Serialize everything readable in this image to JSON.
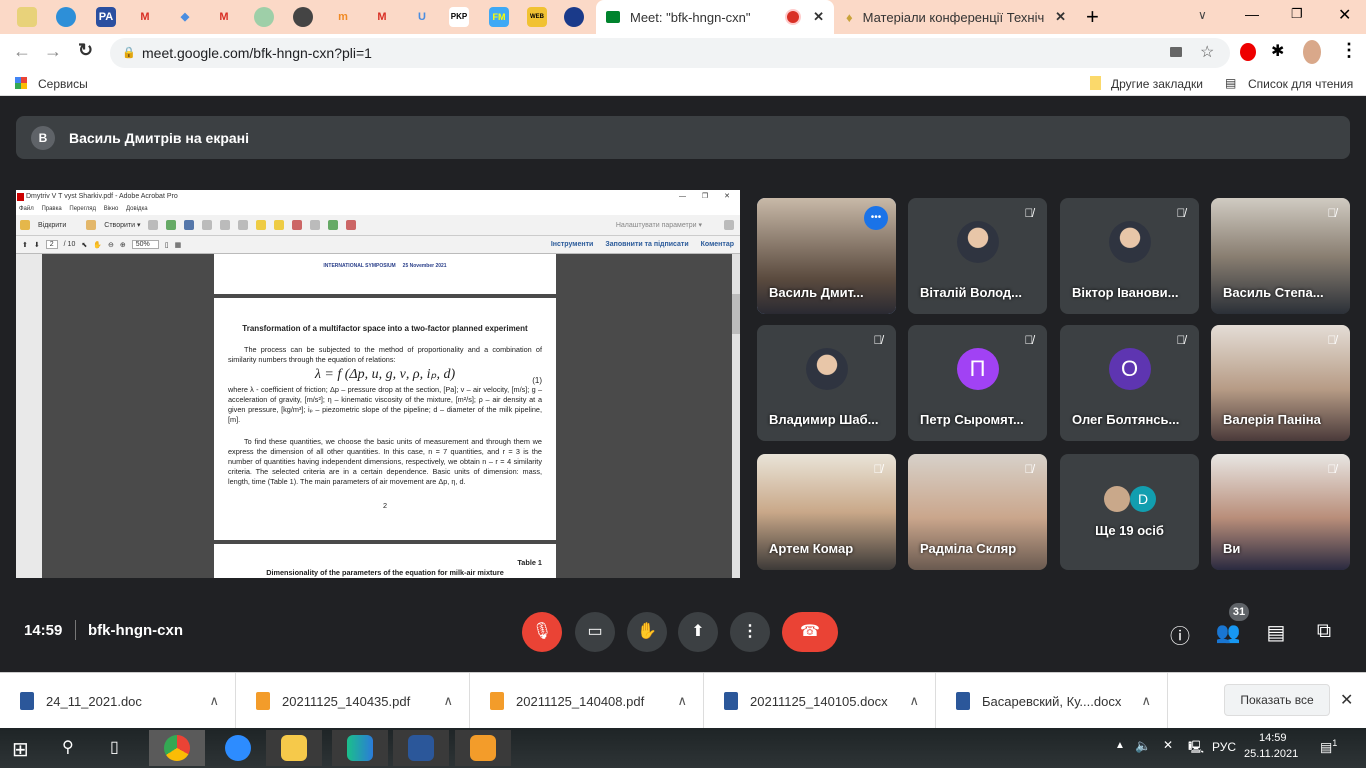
{
  "browser": {
    "pinned_tabs": [
      "crest",
      "drop",
      "pa",
      "gmail",
      "cap",
      "gmail",
      "emblem",
      "globe",
      "m",
      "gmail",
      "u",
      "PKP",
      "FM",
      "WEB",
      "eu"
    ],
    "active_tab": {
      "title": "Meet: \"bfk-hngn-cxn\""
    },
    "other_tab": {
      "title": "Матеріали конференції Технічн"
    },
    "url": "meet.google.com/bfk-hngn-cxn?pli=1",
    "bookmarks": {
      "apps": "Сервисы",
      "other": "Другие закладки",
      "reading_list": "Список для чтения"
    }
  },
  "meet": {
    "presenter_banner": {
      "initial": "В",
      "text": "Василь Дмитрів на екрані"
    },
    "participants": [
      {
        "name": "Василь Дмит...",
        "type": "video",
        "speaking": true
      },
      {
        "name": "Віталій Волод...",
        "type": "photo"
      },
      {
        "name": "Віктор Іванови...",
        "type": "photo"
      },
      {
        "name": "Василь Степа...",
        "type": "video"
      },
      {
        "name": "Владимир Шаб...",
        "type": "photo"
      },
      {
        "name": "Петр Сыромят...",
        "type": "letter",
        "letter": "П",
        "color": "#a142f4"
      },
      {
        "name": "Олег Болтянсь...",
        "type": "letter",
        "letter": "О",
        "color": "#5e35b1"
      },
      {
        "name": "Валерія Паніна",
        "type": "video"
      },
      {
        "name": "Артем Комар",
        "type": "video"
      },
      {
        "name": "Радміла Скляр",
        "type": "video"
      },
      {
        "name": "Ще 19 осіб",
        "type": "more",
        "letter": "D"
      },
      {
        "name": "Ви",
        "type": "video"
      }
    ],
    "time": "14:59",
    "meeting_code": "bfk-hngn-cxn",
    "participant_count": "31"
  },
  "acrobat": {
    "title": "Dmytriv V T vyst Sharkiv.pdf - Adobe Acrobat Pro",
    "menu": [
      "Файл",
      "Правка",
      "Перегляд",
      "Вікно",
      "Довідка"
    ],
    "open": "Відкрити",
    "create": "Створити ▾",
    "customize": "Налаштувати параметри ▾",
    "page_current": "2",
    "page_total": "/ 10",
    "zoom": "50%",
    "tools": "Інструменти",
    "fill_sign": "Заповнити та підписати",
    "comment": "Коментар"
  },
  "document": {
    "header": "INTERNATIONAL SYMPOSIUM     25 November 2021",
    "title": "Transformation of a multifactor space into a two-factor planned experiment",
    "p1": "The process can be subjected to the method of proportionality and a combination of similarity numbers through the equation of relations:",
    "equation": "λ = f (Δp, u, g, ν, ρ, iₚ, d)",
    "eq_num": "(1)",
    "p2": "where λ - coefficient of friction; Δp – pressure drop at the section, [Pa]; v – air velocity, [m/s]; g – acceleration of gravity, [m/s²]; η – kinematic viscosity of the mixture, [m²/s]; ρ – air density at a given pressure, [kg/m³]; iₚ – piezometric slope of the pipeline; d – diameter of the milk pipeline, [m].",
    "p3": "To find these quantities, we choose the basic units of measurement and through them we express the dimension of all other quantities. In this case, n = 7 quantities, and r = 3 is the number of quantities having independent dimensions, respectively, we obtain n – r = 4 similarity criteria. The selected criteria are in a certain dependence. Basic units of dimension: mass, length, time (Table 1). The main parameters of air movement are Δp, η, d.",
    "page_num": "2",
    "table_label": "Table 1",
    "table_title": "Dimensionality of the parameters of the equation for milk-air mixture"
  },
  "downloads": [
    {
      "name": "24_11_2021.doc",
      "kind": "word"
    },
    {
      "name": "20211125_140435.pdf",
      "kind": "pdf"
    },
    {
      "name": "20211125_140408.pdf",
      "kind": "pdf"
    },
    {
      "name": "20211125_140105.docx",
      "kind": "word"
    },
    {
      "name": "Басаревский, Ку....docx",
      "kind": "word"
    }
  ],
  "show_all": "Показать все",
  "taskbar": {
    "lang": "РУС",
    "time": "14:59",
    "date": "25.11.2021",
    "notifications": "1"
  }
}
